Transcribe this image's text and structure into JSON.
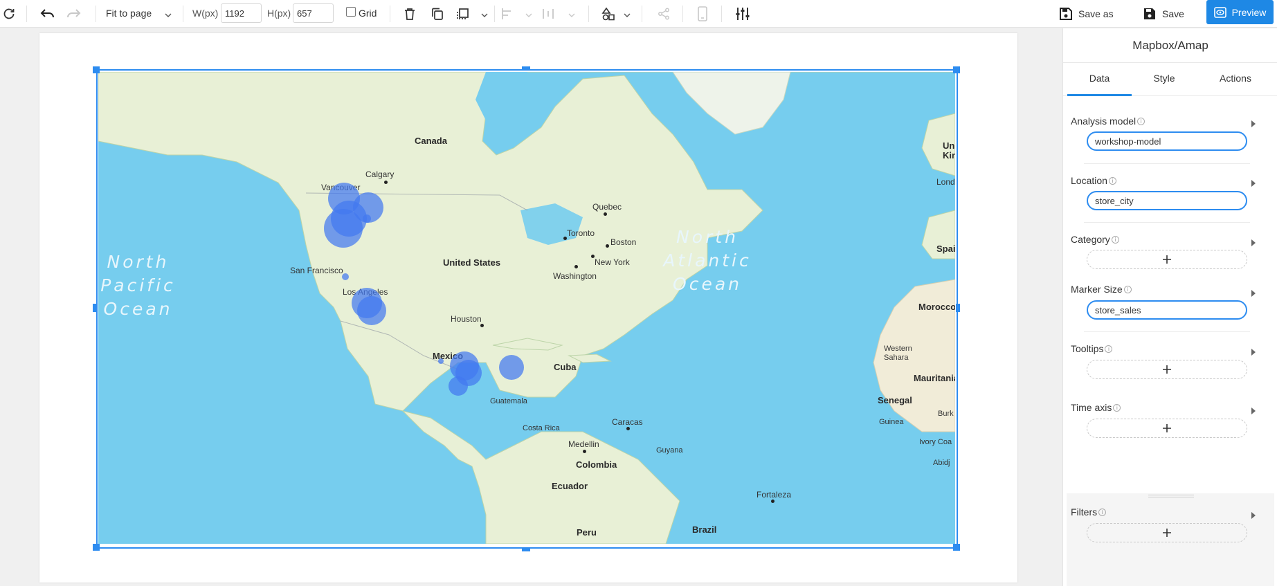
{
  "toolbar": {
    "fit_label": "Fit to page",
    "width_label": "W(px)",
    "width_value": "1192",
    "height_label": "H(px)",
    "height_value": "657",
    "grid_label": "Grid",
    "save_as_label": "Save as",
    "save_label": "Save",
    "preview_label": "Preview"
  },
  "map": {
    "places": {
      "canada": "Canada",
      "calgary": "Calgary",
      "vancouver": "Vancouver",
      "quebec": "Quebec",
      "toronto": "Toronto",
      "boston": "Boston",
      "new_york": "New York",
      "washington": "Washington",
      "united_states": "United States",
      "san_francisco": "San Francisco",
      "los_angeles": "Los Angeles",
      "houston": "Houston",
      "mexico": "Mexico",
      "cuba": "Cuba",
      "guatemala": "Guatemala",
      "costa_rica": "Costa Rica",
      "caracas": "Caracas",
      "medellin": "Medellin",
      "guyana": "Guyana",
      "colombia": "Colombia",
      "ecuador": "Ecuador",
      "fortaleza": "Fortaleza",
      "peru": "Peru",
      "brazil": "Brazil",
      "uk_partial": "Uni\nKing",
      "lond_partial": "Lond",
      "spain_partial": "Spai",
      "morocco": "Morocco",
      "western_sahara": "Western\nSahara",
      "mauritania": "Mauritania",
      "senegal": "Senegal",
      "guinea": "Guinea",
      "ivory_coast_partial": "Ivory Coa",
      "burk_partial": "Burk",
      "abidjan_partial": "Abidj"
    },
    "oceans": {
      "north_pacific": "North\nPacific\nOcean",
      "north_atlantic": "North\nAtlantic\nOcean"
    }
  },
  "panel": {
    "title": "Mapbox/Amap",
    "tabs": [
      "Data",
      "Style",
      "Actions"
    ],
    "active_tab": "Data",
    "fields": {
      "analysis_model": {
        "label": "Analysis model",
        "value": "workshop-model"
      },
      "location": {
        "label": "Location",
        "value": "store_city"
      },
      "category": {
        "label": "Category"
      },
      "marker_size": {
        "label": "Marker Size",
        "value": "store_sales"
      },
      "tooltips": {
        "label": "Tooltips"
      },
      "time_axis": {
        "label": "Time axis"
      },
      "filters": {
        "label": "Filters"
      }
    }
  },
  "colors": {
    "accent": "#1e88e5",
    "selection": "#2d8cf0",
    "ocean": "#76cdee",
    "land": "#e8f0d6",
    "marker": "#4278f0"
  }
}
